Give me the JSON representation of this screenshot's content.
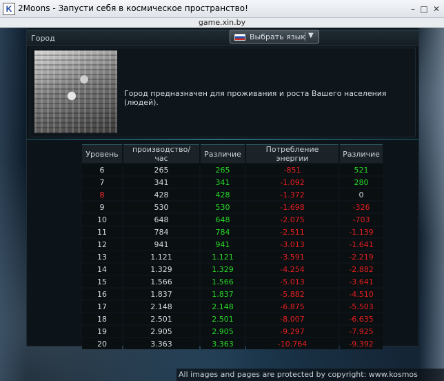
{
  "window": {
    "title": "2Moons - Запусти себя в космическое пространство!",
    "address": "game.xin.by"
  },
  "header": {
    "title": "Город",
    "language_label": "Выбрать язык"
  },
  "building": {
    "description": "Город предназначен для проживания и роста Вашего населения (людей)."
  },
  "table": {
    "columns": [
      "Уровень",
      "производство/час",
      "Различие",
      "Потребление энергии",
      "Различие"
    ],
    "rows": [
      {
        "level": "6",
        "production": "265",
        "diff": "265",
        "energy": "-851",
        "energy_diff": "521"
      },
      {
        "level": "7",
        "production": "341",
        "diff": "341",
        "energy": "-1.092",
        "energy_diff": "280"
      },
      {
        "level": "8",
        "production": "428",
        "diff": "428",
        "energy": "-1.372",
        "energy_diff": "0"
      },
      {
        "level": "9",
        "production": "530",
        "diff": "530",
        "energy": "-1.698",
        "energy_diff": "-326"
      },
      {
        "level": "10",
        "production": "648",
        "diff": "648",
        "energy": "-2.075",
        "energy_diff": "-703"
      },
      {
        "level": "11",
        "production": "784",
        "diff": "784",
        "energy": "-2.511",
        "energy_diff": "-1.139"
      },
      {
        "level": "12",
        "production": "941",
        "diff": "941",
        "energy": "-3.013",
        "energy_diff": "-1.641"
      },
      {
        "level": "13",
        "production": "1.121",
        "diff": "1.121",
        "energy": "-3.591",
        "energy_diff": "-2.219"
      },
      {
        "level": "14",
        "production": "1.329",
        "diff": "1.329",
        "energy": "-4.254",
        "energy_diff": "-2.882"
      },
      {
        "level": "15",
        "production": "1.566",
        "diff": "1.566",
        "energy": "-5.013",
        "energy_diff": "-3.641"
      },
      {
        "level": "16",
        "production": "1.837",
        "diff": "1.837",
        "energy": "-5.882",
        "energy_diff": "-4.510"
      },
      {
        "level": "17",
        "production": "2.148",
        "diff": "2.148",
        "energy": "-6.875",
        "energy_diff": "-5.503"
      },
      {
        "level": "18",
        "production": "2.501",
        "diff": "2.501",
        "energy": "-8.007",
        "energy_diff": "-6.635"
      },
      {
        "level": "19",
        "production": "2.905",
        "diff": "2.905",
        "energy": "-9.297",
        "energy_diff": "-7.925"
      },
      {
        "level": "20",
        "production": "3.363",
        "diff": "3.363",
        "energy": "-10.764",
        "energy_diff": "-9.392"
      }
    ]
  },
  "footer": {
    "copyright": "All images and pages are protected by copyright: www.kosmos"
  },
  "colors": {
    "positive": "#27d827",
    "negative": "#e61f1f",
    "current_level": "#ff2a2a"
  }
}
